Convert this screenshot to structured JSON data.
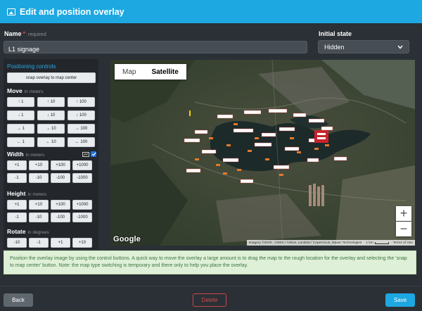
{
  "title": "Edit and position overlay",
  "name_field": {
    "label": "Name",
    "required_marker": "*",
    "hint": "required",
    "value": "L1 signage"
  },
  "initial_state": {
    "label": "Initial state",
    "value": "Hidden"
  },
  "controls": {
    "title": "Positioning controls",
    "snap_label": "snap overlay to map center",
    "move": {
      "label": "Move",
      "hint": "in meters"
    },
    "width": {
      "label": "Width",
      "hint": "in meters"
    },
    "height": {
      "label": "Height",
      "hint": "in meters"
    },
    "rotate": {
      "label": "Rotate",
      "hint": "in degrees"
    },
    "move_rows": [
      [
        "↑ 1",
        "↑ 10",
        "↑ 100"
      ],
      [
        "↓ 1",
        "↓ 10",
        "↓ 100"
      ],
      [
        "→ 1",
        "→ 10",
        "→ 100"
      ],
      [
        "← 1",
        "← 10",
        "← 100"
      ]
    ],
    "width_rows": [
      [
        "+1",
        "+10",
        "+100",
        "+1000"
      ],
      [
        "-1",
        "-10",
        "-100",
        "-1000"
      ]
    ],
    "height_rows": [
      [
        "+1",
        "+10",
        "+100",
        "+1000"
      ],
      [
        "-1",
        "-10",
        "-100",
        "-1000"
      ]
    ],
    "rotate_row": [
      "-10",
      "-1",
      "+1",
      "+10"
    ],
    "aspect_lock_checked": true
  },
  "map": {
    "tab_map": "Map",
    "tab_satellite": "Satellite",
    "active_tab": "Satellite",
    "zoom_in": "+",
    "zoom_out": "−",
    "brand": "Google",
    "attribution": "Imagery ©2020 , CNES / Airbus, Landsat / Copernicus, Maxar Technologies",
    "scale": "1 km",
    "terms": "Terms of Use"
  },
  "note": "Position the overlay image by using the control buttons. A quick way to move the overlay a large amount is to drag the map to the rough location for the overlay and selecting the 'snap to map center' button. Note: the map type switching is temporary and there only to help you place the overlay.",
  "footer": {
    "back": "Back",
    "delete": "Delete",
    "save": "Save"
  },
  "colors": {
    "accent": "#1da8e2",
    "danger": "#e04646",
    "panel": "#23272c",
    "background": "#2b3036"
  }
}
